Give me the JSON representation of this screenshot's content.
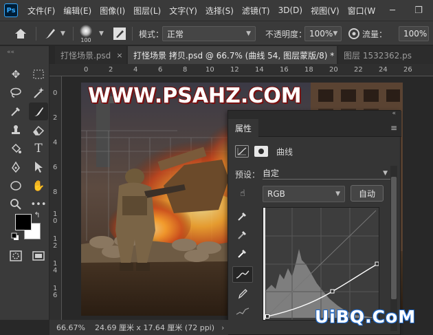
{
  "app": {
    "logo": "Ps"
  },
  "menu": [
    "文件(F)",
    "编辑(E)",
    "图像(I)",
    "图层(L)",
    "文字(Y)",
    "选择(S)",
    "滤镜(T)",
    "3D(D)",
    "视图(V)",
    "窗口(W"
  ],
  "window_controls": {
    "minimize": "─",
    "restore": "❐"
  },
  "options": {
    "brush_size": "100",
    "mode_label": "模式：",
    "mode_value": "正常",
    "opacity_label": "不透明度：",
    "opacity_value": "100%",
    "flow_label": "流量：",
    "flow_value": "100%"
  },
  "tabs": [
    {
      "label": "打怪场景.psd",
      "close": "×"
    },
    {
      "label": "打怪场景 拷贝.psd @ 66.7% (曲线 54, 图层蒙版/8) *",
      "close": "×"
    },
    {
      "label": "图层 1532362.ps"
    }
  ],
  "tabs_grip": "««",
  "ruler": {
    "h_ticks": [
      "0",
      "2",
      "4",
      "6",
      "8",
      "10",
      "12",
      "14",
      "16",
      "18",
      "20",
      "22",
      "24",
      "26"
    ],
    "v_ticks": [
      [
        "0"
      ],
      [
        "2"
      ],
      [
        "4"
      ],
      [
        "6"
      ],
      [
        "8"
      ],
      [
        "1",
        "0"
      ],
      [
        "1",
        "2"
      ],
      [
        "1",
        "4"
      ],
      [
        "1",
        "6"
      ]
    ]
  },
  "canvas": {
    "watermark": "WWW.PSAHZ.COM"
  },
  "properties_panel": {
    "collapse": "«",
    "title": "属性",
    "menu": "≡",
    "adjustment_label": "曲线",
    "preset_label": "预设：",
    "preset_value": "自定",
    "channel_value": "RGB",
    "auto_button": "自动"
  },
  "status": {
    "zoom": "66.67%",
    "doc_size": "24.69 厘米 x 17.64 厘米 (72 ppi)",
    "arrow": "›"
  },
  "corner_logo": "UiBQ.CoM",
  "colors": {
    "accent": "#31a8ff",
    "foreground_swatch": "#000000",
    "background_swatch": "#ffffff"
  }
}
